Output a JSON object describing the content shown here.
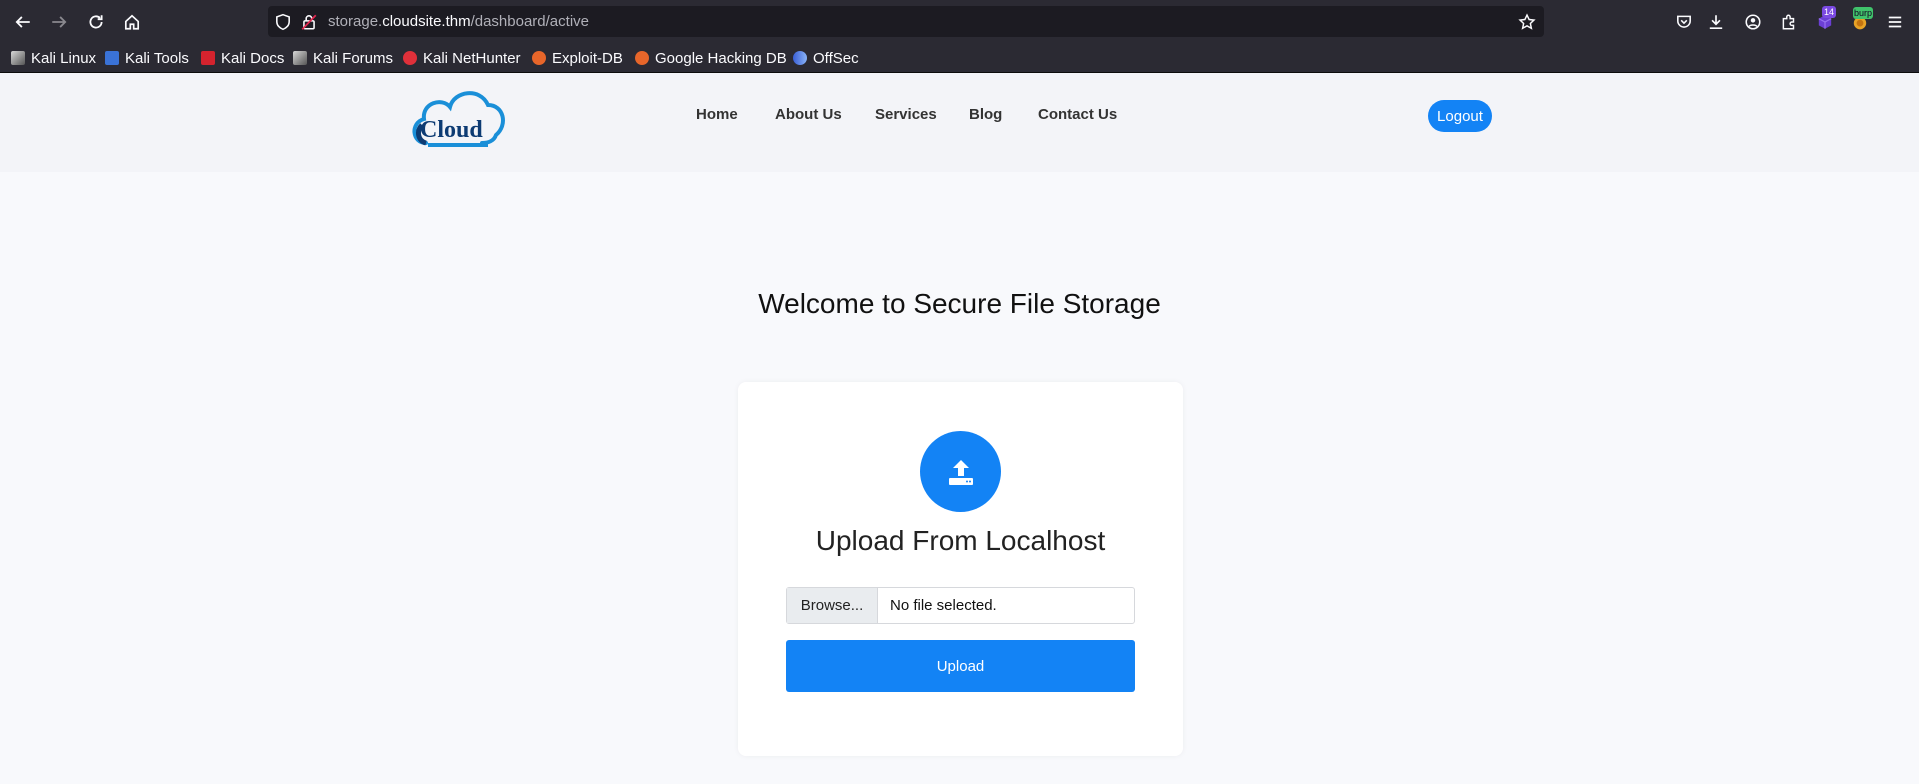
{
  "browser": {
    "url_prefix": "storage.",
    "url_host": "cloudsite.thm",
    "url_path": "/dashboard/active",
    "bookmarks": [
      {
        "label": "Kali Linux",
        "icon": "kali-dragon-icon"
      },
      {
        "label": "Kali Tools",
        "icon": "kali-tools-icon"
      },
      {
        "label": "Kali Docs",
        "icon": "kali-docs-icon"
      },
      {
        "label": "Kali Forums",
        "icon": "kali-dragon-icon"
      },
      {
        "label": "Kali NetHunter",
        "icon": "nethunter-icon"
      },
      {
        "label": "Exploit-DB",
        "icon": "exploitdb-icon"
      },
      {
        "label": "Google Hacking DB",
        "icon": "exploitdb-icon"
      },
      {
        "label": "OffSec",
        "icon": "offsec-icon"
      }
    ],
    "extension_badge": "14",
    "burp_badge": "burp"
  },
  "site": {
    "logo_text": "Cloud",
    "nav": [
      "Home",
      "About Us",
      "Services",
      "Blog",
      "Contact Us"
    ],
    "logout_label": "Logout"
  },
  "main": {
    "welcome": "Welcome to Secure File Storage",
    "card_title": "Upload From Localhost",
    "browse_label": "Browse...",
    "file_status": "No file selected.",
    "upload_label": "Upload"
  },
  "colors": {
    "accent": "#1383f5",
    "chrome": "#2b2a33",
    "logo_dark": "#0d3b73"
  }
}
